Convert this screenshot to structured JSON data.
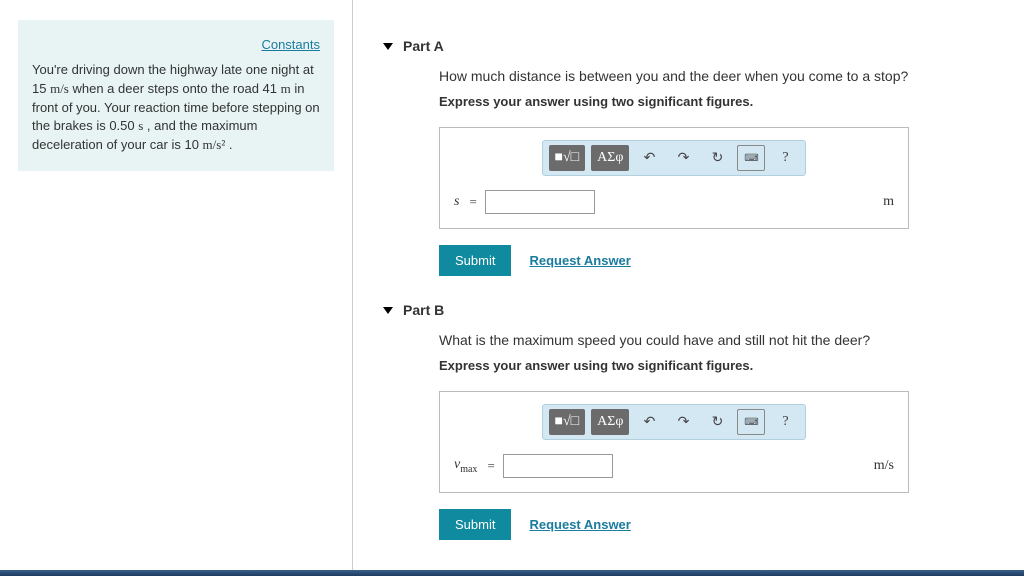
{
  "info": {
    "constants_link": "Constants",
    "line1": "You're driving down the highway late one night at",
    "line2_pre": "15 ",
    "line2_unit": "m/s",
    "line2_mid": " when a deer steps onto the road 41 ",
    "line2_unit2": "m",
    "line2_post": " in",
    "line3": "front of you. Your reaction time before stepping on",
    "line4_pre": "the brakes is 0.50 ",
    "line4_unit": "s",
    "line4_post": " , and the maximum",
    "line5_pre": "deceleration of your car is 10 ",
    "line5_unit": "m/s²",
    "line5_post": " ."
  },
  "partA": {
    "label": "Part A",
    "question": "How much distance is between you and the deer when you come to a stop?",
    "instruction": "Express your answer using two significant figures.",
    "variable": "s",
    "equals": "=",
    "unit": "m",
    "submit": "Submit",
    "request": "Request Answer"
  },
  "partB": {
    "label": "Part B",
    "question": "What is the maximum speed you could have and still not hit the deer?",
    "instruction": "Express your answer using two significant figures.",
    "variable": "v",
    "variable_sub": "max",
    "equals": "=",
    "unit": "m/s",
    "submit": "Submit",
    "request": "Request Answer"
  },
  "toolbar": {
    "format": "■√□",
    "greek": "ΑΣφ",
    "undo": "↶",
    "redo": "↷",
    "reset": "↻",
    "keyboard": "⌨",
    "help": "?"
  }
}
